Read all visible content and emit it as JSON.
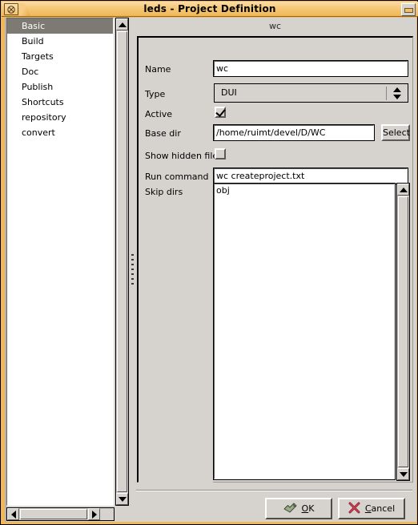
{
  "window": {
    "title": "leds - Project Definition",
    "close_icon": "close-circle-x-icon",
    "minimize_icon": "minimize-icon",
    "accent_titlebar": "#f0b757",
    "face_color": "#d6d3ce"
  },
  "sidebar": {
    "items": [
      {
        "label": "Basic",
        "selected": true
      },
      {
        "label": "Build",
        "selected": false
      },
      {
        "label": "Targets",
        "selected": false
      },
      {
        "label": "Doc",
        "selected": false
      },
      {
        "label": "Publish",
        "selected": false
      },
      {
        "label": "Shortcuts",
        "selected": false
      },
      {
        "label": "repository",
        "selected": false
      },
      {
        "label": "convert",
        "selected": false
      }
    ],
    "selection_color": "#7c7a72"
  },
  "tab": {
    "label": "wc"
  },
  "form": {
    "name": {
      "label": "Name",
      "value": "wc"
    },
    "type": {
      "label": "Type",
      "value": "DUI",
      "up_icon": "spinner-up-icon",
      "down_icon": "spinner-down-icon"
    },
    "active": {
      "label": "Active",
      "checked": true
    },
    "base_dir": {
      "label": "Base dir",
      "value": "/home/ruimt/devel/D/WC",
      "select_button": "Select"
    },
    "show_hidden": {
      "label": "Show hidden files",
      "checked": false
    },
    "run_command": {
      "label": "Run command",
      "value": "wc createproject.txt"
    },
    "skip_dirs": {
      "label": "Skip dirs",
      "value": "obj"
    }
  },
  "actions": {
    "ok": {
      "label": "OK",
      "mnemonic": "O",
      "rest": "K",
      "icon": "check-arrow-icon"
    },
    "cancel": {
      "label": "Cancel",
      "mnemonic": "C",
      "rest": "ancel",
      "icon": "cross-x-icon"
    }
  },
  "scrollbars": {
    "sidebar_vertical": "sidebar-vertical-scrollbar",
    "sidebar_horizontal": "sidebar-horizontal-scrollbar",
    "skipdirs_vertical": "skipdirs-vertical-scrollbar"
  }
}
